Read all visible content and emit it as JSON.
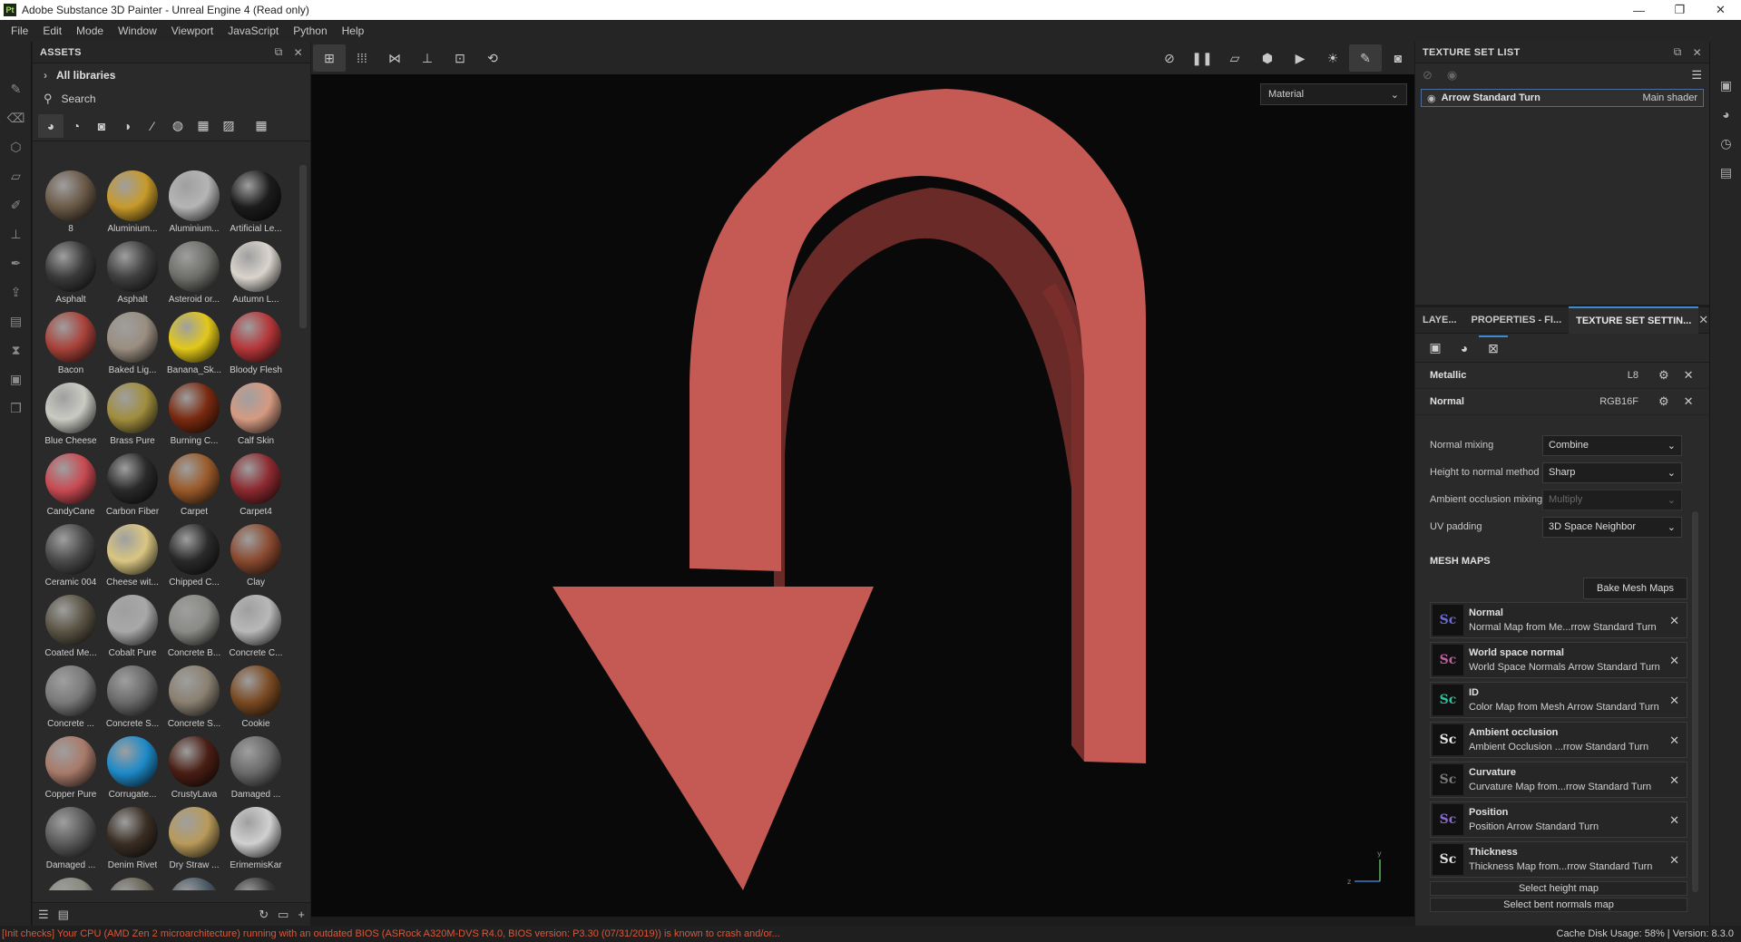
{
  "window": {
    "title": "Adobe Substance 3D Painter - Unreal Engine 4 (Read only)",
    "app_badge": "Pt",
    "controls": [
      "—",
      "❐",
      "✕"
    ]
  },
  "menu": [
    "File",
    "Edit",
    "Mode",
    "Window",
    "Viewport",
    "JavaScript",
    "Python",
    "Help"
  ],
  "assets": {
    "title": "ASSETS",
    "library": "All libraries",
    "search_placeholder": "Search",
    "items": [
      {
        "label": "8",
        "color": "#6b5a48"
      },
      {
        "label": "Aluminium...",
        "color": "#c79a2a"
      },
      {
        "label": "Aluminium...",
        "color": "#b5b5b5"
      },
      {
        "label": "Artificial Le...",
        "color": "#1c1c1c"
      },
      {
        "label": "Asphalt",
        "color": "#3a3a3a"
      },
      {
        "label": "Asphalt",
        "color": "#3f3f3f"
      },
      {
        "label": "Asteroid or...",
        "color": "#6e6e6a"
      },
      {
        "label": "Autumn L...",
        "color": "#d9d4cc"
      },
      {
        "label": "Bacon",
        "color": "#a8423a"
      },
      {
        "label": "Baked Lig...",
        "color": "#9a8e80"
      },
      {
        "label": "Banana_Sk...",
        "color": "#e2c81a"
      },
      {
        "label": "Bloody Flesh",
        "color": "#b5373a"
      },
      {
        "label": "Blue Cheese",
        "color": "#c9cbc2"
      },
      {
        "label": "Brass Pure",
        "color": "#a08d3e"
      },
      {
        "label": "Burning C...",
        "color": "#7a2a10"
      },
      {
        "label": "Calf Skin",
        "color": "#d59a82"
      },
      {
        "label": "CandyCane",
        "color": "#c84a52"
      },
      {
        "label": "Carbon Fiber",
        "color": "#2a2a2a"
      },
      {
        "label": "Carpet",
        "color": "#9a5a2a"
      },
      {
        "label": "Carpet4",
        "color": "#8c2a30"
      },
      {
        "label": "Ceramic 004",
        "color": "#4a4a4a"
      },
      {
        "label": "Cheese wit...",
        "color": "#d9c682"
      },
      {
        "label": "Chipped C...",
        "color": "#2a2a2a"
      },
      {
        "label": "Clay",
        "color": "#8a4a30"
      },
      {
        "label": "Coated Me...",
        "color": "#5a5444"
      },
      {
        "label": "Cobalt Pure",
        "color": "#a8a8a8"
      },
      {
        "label": "Concrete B...",
        "color": "#8a8a86"
      },
      {
        "label": "Concrete C...",
        "color": "#b8b8b8"
      },
      {
        "label": "Concrete ...",
        "color": "#7a7a7a"
      },
      {
        "label": "Concrete S...",
        "color": "#6a6a6a"
      },
      {
        "label": "Concrete S...",
        "color": "#8a8070"
      },
      {
        "label": "Cookie",
        "color": "#7a4a22"
      },
      {
        "label": "Copper Pure",
        "color": "#a87a6a"
      },
      {
        "label": "Corrugate...",
        "color": "#1e8ac8"
      },
      {
        "label": "CrustyLava",
        "color": "#4a1e14"
      },
      {
        "label": "Damaged ...",
        "color": "#6a6a6a"
      },
      {
        "label": "Damaged ...",
        "color": "#5a5a5a"
      },
      {
        "label": "Denim Rivet",
        "color": "#3a2e24"
      },
      {
        "label": "Dry Straw ...",
        "color": "#b89a5a"
      },
      {
        "label": "ErimemisKar",
        "color": "#d0d0d0"
      },
      {
        "label": "",
        "color": "#8a8a80"
      },
      {
        "label": "",
        "color": "#6a6658"
      },
      {
        "label": "",
        "color": "#4a5a66"
      },
      {
        "label": "",
        "color": "#3a3a3a"
      }
    ]
  },
  "viewport": {
    "mode_select": "Material"
  },
  "texture_set_list": {
    "title": "TEXTURE SET LIST",
    "item_name": "Arrow Standard Turn",
    "item_shader": "Main shader"
  },
  "tabs": {
    "layers": "LAYE...",
    "properties": "PROPERTIES - FI...",
    "texture_set_settings": "TEXTURE SET SETTIN..."
  },
  "channels": [
    {
      "name": "Metallic",
      "format": "L8"
    },
    {
      "name": "Normal",
      "format": "RGB16F"
    }
  ],
  "settings": [
    {
      "label": "Normal mixing",
      "value": "Combine",
      "disabled": false
    },
    {
      "label": "Height to normal method",
      "value": "Sharp",
      "disabled": false
    },
    {
      "label": "Ambient occlusion mixing",
      "value": "Multiply",
      "disabled": true
    },
    {
      "label": "UV padding",
      "value": "3D Space Neighbor",
      "disabled": false
    }
  ],
  "mesh_maps": {
    "title": "MESH MAPS",
    "bake_button": "Bake Mesh Maps",
    "items": [
      {
        "name": "Normal",
        "desc": "Normal Map from Me...rrow Standard Turn",
        "color": "#6a6ad8"
      },
      {
        "name": "World space normal",
        "desc": "World Space Normals Arrow Standard Turn",
        "color": "#c060a0"
      },
      {
        "name": "ID",
        "desc": "Color Map from Mesh Arrow Standard Turn",
        "color": "#30c0a0"
      },
      {
        "name": "Ambient occlusion",
        "desc": "Ambient Occlusion ...rrow Standard Turn",
        "color": "#e8e8e8"
      },
      {
        "name": "Curvature",
        "desc": "Curvature Map from...rrow Standard Turn",
        "color": "#7a7a7a"
      },
      {
        "name": "Position",
        "desc": "Position Arrow Standard Turn",
        "color": "#8a6ad0"
      },
      {
        "name": "Thickness",
        "desc": "Thickness Map from...rrow Standard Turn",
        "color": "#e0e0e0"
      }
    ],
    "select_height": "Select height map",
    "select_bent": "Select bent normals map"
  },
  "status": {
    "warning": "[Init checks] Your CPU (AMD Zen 2 microarchitecture) running with an outdated BIOS (ASRock A320M-DVS R4.0, BIOS version: P3.30 (07/31/2019)) is known to crash and/or...",
    "cache": "Cache Disk Usage:   58% | Version: 8.3.0"
  },
  "colors": {
    "arrow": "#c55a55",
    "accent": "#3d8bd4",
    "warning": "#d9583a"
  }
}
